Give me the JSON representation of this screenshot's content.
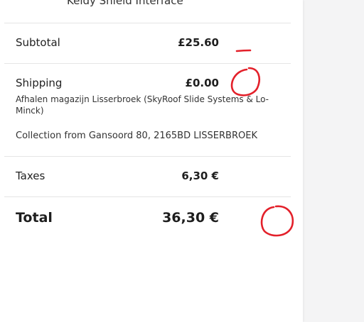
{
  "product": {
    "name": "Keidy Shield Interface"
  },
  "summary": {
    "subtotal_label": "Subtotal",
    "subtotal_value": "£25.60",
    "shipping_label": "Shipping",
    "shipping_value": "£0.00",
    "shipping_method": "Afhalen magazijn Lisserbroek (SkyRoof Slide Systems & Lo-Minck)",
    "collection_address": "Collection from Gansoord 80, 2165BD LISSERBROEK",
    "taxes_label": "Taxes",
    "taxes_value": "6,30 €",
    "total_label": "Total",
    "total_value": "36,30 €"
  },
  "annotation_color": "#e3202a"
}
